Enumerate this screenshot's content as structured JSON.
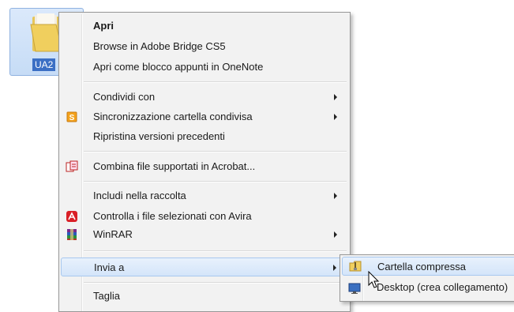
{
  "desktop": {
    "folder_label": "UA2"
  },
  "context_menu": {
    "items": [
      {
        "label": "Apri",
        "bold": true
      },
      {
        "label": "Browse in Adobe Bridge CS5"
      },
      {
        "label": "Apri come blocco appunti in OneNote"
      },
      {
        "label": "Condividi con"
      },
      {
        "label": "Sincronizzazione cartella condivisa",
        "icon": "sync-folder-icon"
      },
      {
        "label": "Ripristina versioni precedenti"
      },
      {
        "label": "Combina file supportati in Acrobat...",
        "icon": "acrobat-combine-icon"
      },
      {
        "label": "Includi nella raccolta"
      },
      {
        "label": "Controlla i file selezionati con Avira",
        "icon": "avira-icon"
      },
      {
        "label": "WinRAR",
        "icon": "winrar-icon"
      },
      {
        "label": "Invia a"
      },
      {
        "label": "Taglia"
      }
    ]
  },
  "send_to_submenu": {
    "items": [
      {
        "label": "Cartella compressa",
        "icon": "zip-folder-icon"
      },
      {
        "label": "Desktop (crea collegamento)",
        "icon": "desktop-icon"
      }
    ]
  },
  "colors": {
    "menu_bg": "#f2f2f2",
    "highlight": "#d4e5fa",
    "selection_label": "#3b6fc4"
  }
}
